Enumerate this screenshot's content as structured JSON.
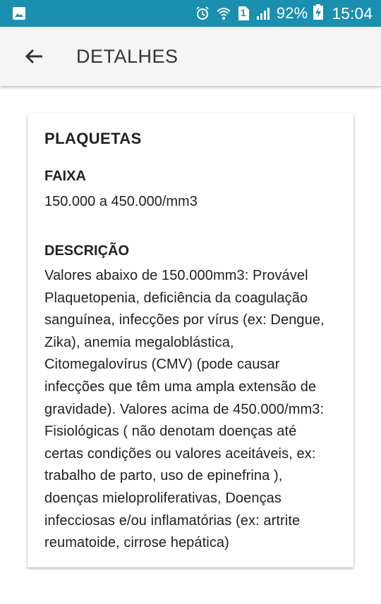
{
  "status_bar": {
    "battery": "92%",
    "time": "15:04",
    "sim_slot": "1",
    "icons": [
      "image-icon",
      "alarm-icon",
      "wifi-icon",
      "sim-icon",
      "signal-icon",
      "battery-charging-icon"
    ]
  },
  "app_bar": {
    "title": "DETALHES",
    "back_icon": "arrow-back-icon"
  },
  "card": {
    "title": "PLAQUETAS",
    "faixa_label": "FAIXA",
    "faixa_value": "150.000 a 450.000/mm3",
    "descricao_label": "DESCRIÇÃO",
    "descricao_value": "Valores abaixo de 150.000mm3: Provável Plaquetopenia, deficiência da coagulação sanguínea, infecções por vírus (ex: Dengue, Zika), anemia megaloblástica, Citomegalovírus (CMV) (pode causar infecções que têm uma ampla extensão de gravidade). Valores acima de 450.000/mm3: Fisiológicas ( não denotam doenças até certas condições ou valores aceitáveis, ex: trabalho de parto, uso de epinefrina ), doenças mieloproliferativas, Doenças infecciosas e/ou inflamatórias (ex: artrite reumatoide, cirrose hepática)"
  },
  "colors": {
    "status_bar": "#1a8fb0",
    "app_bar": "#f5f5f5",
    "text": "#212121"
  }
}
